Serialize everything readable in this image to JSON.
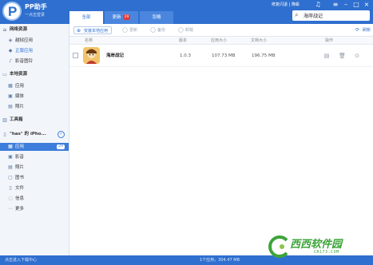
{
  "header": {
    "brand": "PP助手",
    "login": "一点击登录",
    "tabs": [
      {
        "label": "全部",
        "active": true
      },
      {
        "label": "更新",
        "badge": "29"
      },
      {
        "label": "忽略"
      }
    ],
    "link": "修复闪退 | 降級",
    "icons": [
      "music-icon",
      "menu-icon",
      "minimize-icon",
      "maximize-icon",
      "close-icon"
    ],
    "search": {
      "value": "海岸战记"
    }
  },
  "sidebar": {
    "network": {
      "title": "网络资源",
      "items": [
        "越狱应用",
        "正版应用",
        "影音图铃"
      ]
    },
    "local": {
      "title": "本地资源",
      "items": [
        "应用",
        "媒体",
        "照片"
      ]
    },
    "toolbox": {
      "title": "工具箱"
    },
    "device": {
      "title": "\"has\" 的 iPho...",
      "items": [
        {
          "label": "应用",
          "badge": "29"
        },
        {
          "label": "影音"
        },
        {
          "label": "照片"
        },
        {
          "label": "图书"
        },
        {
          "label": "文件"
        },
        {
          "label": "信息"
        },
        {
          "label": "更多"
        }
      ]
    }
  },
  "toolbar": {
    "install": "安装本地应用",
    "update": "更新",
    "backup": "备份",
    "uninstall": "卸载",
    "refresh": "刷新"
  },
  "table": {
    "columns": {
      "name": "名称",
      "version": "版本",
      "app_size": "应用大小",
      "doc_size": "文档大小",
      "actions": "操作"
    },
    "rows": [
      {
        "name": "海岸战记",
        "version": "1.0.3",
        "app_size": "107.73 MB",
        "doc_size": "196.75 MB"
      }
    ]
  },
  "footer": {
    "left": "点击进入下载中心",
    "status": "1个应用，304.47 MB"
  },
  "watermark": {
    "text": "西西软件园",
    "sub": "CR173.COM"
  },
  "colors": {
    "accent": "#2f6fcf",
    "selected": "#3d7ddb",
    "badge": "#e53935"
  }
}
